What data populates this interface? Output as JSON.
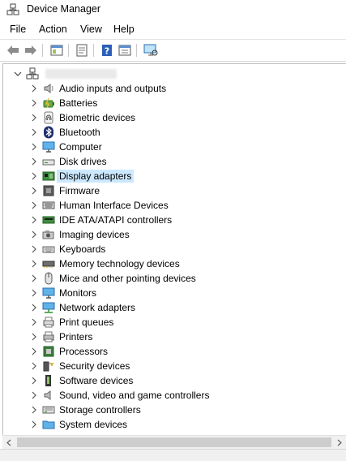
{
  "window": {
    "title": "Device Manager"
  },
  "menu": {
    "file": "File",
    "action": "Action",
    "view": "View",
    "help": "Help"
  },
  "tree": {
    "items": [
      {
        "label": "Audio inputs and outputs",
        "icon": "speaker-icon"
      },
      {
        "label": "Batteries",
        "icon": "battery-icon"
      },
      {
        "label": "Biometric devices",
        "icon": "fingerprint-icon"
      },
      {
        "label": "Bluetooth",
        "icon": "bluetooth-icon"
      },
      {
        "label": "Computer",
        "icon": "computer-icon"
      },
      {
        "label": "Disk drives",
        "icon": "disk-drive-icon"
      },
      {
        "label": "Display adapters",
        "icon": "display-adapter-icon",
        "selected": true
      },
      {
        "label": "Firmware",
        "icon": "firmware-chip-icon"
      },
      {
        "label": "Human Interface Devices",
        "icon": "hid-icon"
      },
      {
        "label": "IDE ATA/ATAPI controllers",
        "icon": "ide-controller-icon"
      },
      {
        "label": "Imaging devices",
        "icon": "camera-icon"
      },
      {
        "label": "Keyboards",
        "icon": "keyboard-icon"
      },
      {
        "label": "Memory technology devices",
        "icon": "memory-icon"
      },
      {
        "label": "Mice and other pointing devices",
        "icon": "mouse-icon"
      },
      {
        "label": "Monitors",
        "icon": "monitor-icon"
      },
      {
        "label": "Network adapters",
        "icon": "network-adapter-icon"
      },
      {
        "label": "Print queues",
        "icon": "print-queue-icon"
      },
      {
        "label": "Printers",
        "icon": "printer-icon"
      },
      {
        "label": "Processors",
        "icon": "processor-icon"
      },
      {
        "label": "Security devices",
        "icon": "security-key-icon"
      },
      {
        "label": "Software devices",
        "icon": "software-device-icon"
      },
      {
        "label": "Sound, video and game controllers",
        "icon": "sound-controller-icon"
      },
      {
        "label": "Storage controllers",
        "icon": "storage-controller-icon"
      },
      {
        "label": "System devices",
        "icon": "system-folder-icon"
      }
    ]
  },
  "colors": {
    "selection": "#cce8ff",
    "accent": "#0078d7"
  }
}
